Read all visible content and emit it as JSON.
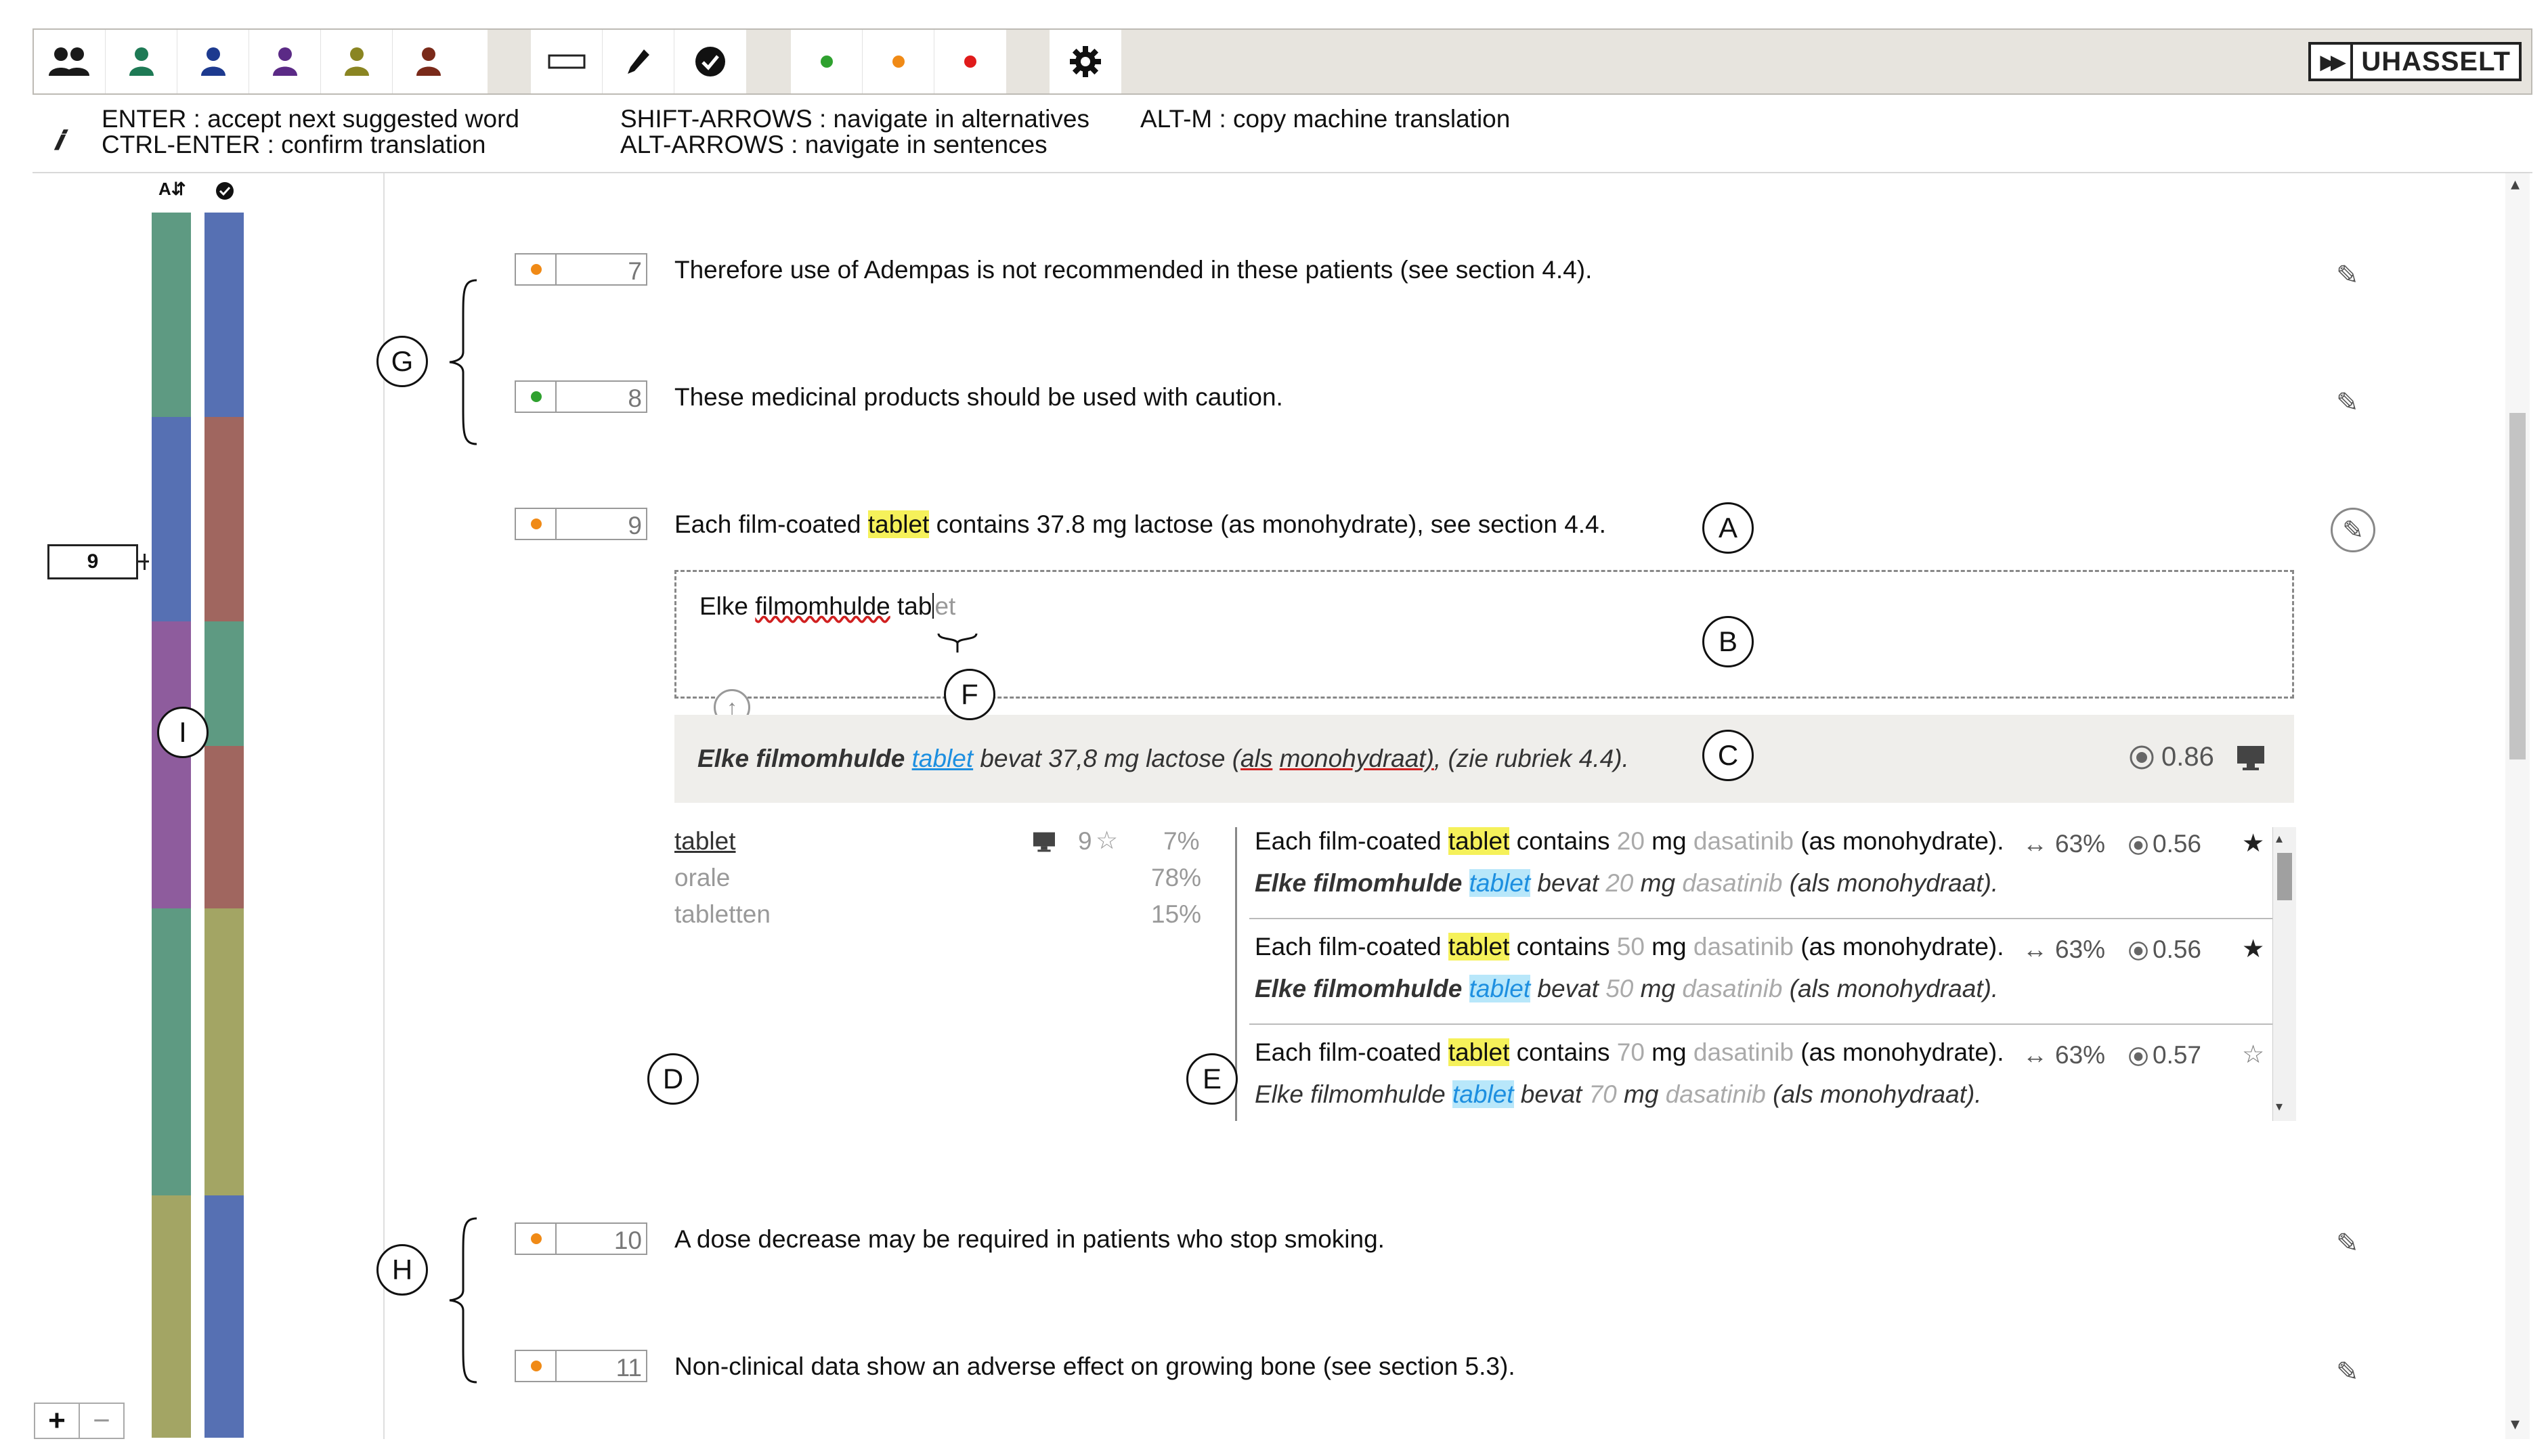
{
  "toolbar": {
    "user_buttons": [
      {
        "icon": "users-group-icon",
        "color": "#1a1a1a"
      },
      {
        "icon": "user-icon",
        "color": "#1e7a55"
      },
      {
        "icon": "user-icon",
        "color": "#1d3a8f"
      },
      {
        "icon": "user-icon",
        "color": "#5b2a86"
      },
      {
        "icon": "user-icon",
        "color": "#8a8522"
      },
      {
        "icon": "user-icon",
        "color": "#7a2a1a"
      }
    ],
    "tool_buttons": [
      "rectangle-icon",
      "pencil-icon",
      "check-circle-icon"
    ],
    "status_buttons": [
      {
        "icon": "dot-icon",
        "color": "#2fa12f"
      },
      {
        "icon": "dot-icon",
        "color": "#f08a16"
      },
      {
        "icon": "dot-icon",
        "color": "#e01b1b"
      }
    ],
    "settings_icon": "gear-icon",
    "logo_text": "UHASSELT"
  },
  "shortcuts": {
    "col1_line1": "ENTER : accept next suggested word",
    "col1_line2": "CTRL-ENTER : confirm translation",
    "col2_line1": "SHIFT-ARROWS : navigate in alternatives",
    "col2_line2": "ALT-ARROWS : navigate in sentences",
    "col3_line1": "ALT-M : copy machine translation"
  },
  "left_panel": {
    "header_icon_1": "text-size-icon",
    "header_icon_2": "check-circle-icon",
    "current_sentence": "9",
    "zoom_in": "+",
    "zoom_out": "−",
    "bar1_colors": [
      "#5e9a82",
      "#5670b3",
      "#8e5c9d",
      "#5e9a82",
      "#a3a564"
    ],
    "bar2_colors": [
      "#5670b3",
      "#a0665f",
      "#5e9a82",
      "#a0665f",
      "#a3a564",
      "#5670b3"
    ]
  },
  "sentences": [
    {
      "num": "7",
      "status_color": "#f08a16",
      "text": "Therefore use of Adempas is not recommended in these patients (see section 4.4)."
    },
    {
      "num": "8",
      "status_color": "#2fa12f",
      "text": "These medicinal products should be used with caution."
    },
    {
      "num": "9",
      "status_color": "#f08a16",
      "text_before": "Each film-coated ",
      "text_highlight": "tablet",
      "text_after": " contains 37.8 mg lactose (as monohydrate), see section 4.4."
    },
    {
      "num": "10",
      "status_color": "#f08a16",
      "text": "A dose decrease may be required in patients who stop smoking."
    },
    {
      "num": "11",
      "status_color": "#f08a16",
      "text": "Non-clinical data show an adverse effect on growing bone (see section 5.3)."
    }
  ],
  "editor": {
    "word1": "Elke",
    "word2": "filmomhulde",
    "typed": "tab",
    "suggestion": "et"
  },
  "machine_translation": {
    "bold_part": "Elke filmomhulde",
    "highlight": "tablet",
    "mid": "bevat 37,8 mg lactose (",
    "als": "als",
    "space": " ",
    "monohydraat": "monohydraat)",
    "end": ", (zie rubriek 4.4).",
    "score": "0.86",
    "score_icon": "target-icon",
    "mt_icon": "monitor-icon"
  },
  "alternatives": [
    {
      "word": "tablet",
      "count": "9",
      "percent": "7%"
    },
    {
      "word": "orale",
      "percent": "78%"
    },
    {
      "word": "tabletten",
      "percent": "15%"
    }
  ],
  "tm_matches": [
    {
      "src_a": "Each film-coated ",
      "src_hl": "tablet",
      "src_b": " contains ",
      "num": "20",
      "unit": " mg ",
      "drug": "dasatinib",
      "src_c": " (as monohydrate).",
      "match": "63%",
      "score": "0.56",
      "star": "★",
      "tgt_a": "Elke filmomhulde ",
      "tgt_hl": "tablet",
      "tgt_b": " bevat ",
      "tgt_c": " (als monohydraat)."
    },
    {
      "src_a": "Each film-coated ",
      "src_hl": "tablet",
      "src_b": " contains ",
      "num": "50",
      "unit": " mg ",
      "drug": "dasatinib",
      "src_c": " (as monohydrate).",
      "match": "63%",
      "score": "0.56",
      "star": "★",
      "tgt_a": "Elke filmomhulde ",
      "tgt_hl": "tablet",
      "tgt_b": " bevat ",
      "tgt_c": " (als monohydraat)."
    },
    {
      "src_a": "Each film-coated ",
      "src_hl": "tablet",
      "src_b": " contains ",
      "num": "70",
      "unit": " mg ",
      "drug": "dasatinib",
      "src_c": " (as monohydrate).",
      "match": "63%",
      "score": "0.57",
      "star": "☆",
      "tgt_a": "Elke filmomhulde ",
      "tgt_hl": "tablet",
      "tgt_b": " bevat ",
      "tgt_c": " (als monohydraat)."
    }
  ],
  "annotations": {
    "A": "A",
    "B": "B",
    "C": "C",
    "D": "D",
    "E": "E",
    "F": "F",
    "G": "G",
    "H": "H",
    "I": "I"
  }
}
